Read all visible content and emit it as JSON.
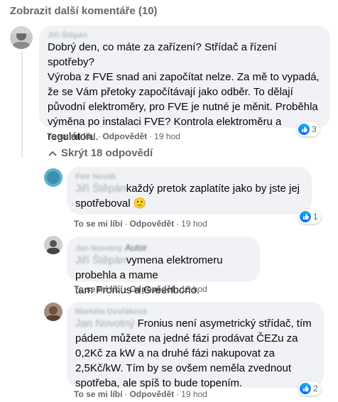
{
  "more_comments": "Zobrazit další komentáře (10)",
  "actions": {
    "like": "To se mi líbí",
    "reply": "Odpovědět",
    "sep": "·"
  },
  "reply_toggle": "Skrýt 18 odpovědí",
  "colors": {
    "like_blue": "#0866ff",
    "bubble_bg": "#f0f2f5",
    "secondary_text": "#65676b"
  },
  "main_comment": {
    "author": "Jiří Štěpán",
    "lines": [
      "Dobrý den, co máte za zařízení? Střídač a řízení spotřeby?",
      "Výroba z FVE snad ani započítat nelze. Za mě to vypadá,",
      "že se Vám přetoky započítávají jako odběr. To dělají",
      "původní elektroměry, pro FVE je nutné je měnit. Proběhla",
      "výměna po instalaci FVE? Kontrola elektroměru a",
      "regulátoru."
    ],
    "time": "19 hod",
    "reactions": "3"
  },
  "replies": [
    {
      "author": "Petr Novák",
      "mention": "Jiří Štěpán",
      "lines": [
        "každý pretok zaplatíte jako by jste jej",
        "spotřeboval 🙂"
      ],
      "time": "19 hod",
      "reactions": "1"
    },
    {
      "author": "Jan Novotný",
      "badge": "Autor",
      "mention": "Jiří Štěpán",
      "lines": [
        "vymena elektromeru probehla a mame",
        "tam Fronius a Greenbono."
      ],
      "time": "19 hod"
    },
    {
      "author": "Markéta Dvořáková",
      "mention": "Jan Novotný",
      "lines": [
        "Fronius není asymetrický střídač, tím",
        "pádem můžete na jedné fázi prodávat ČEZu za",
        "0,2Kč za kW a na druhé fázi nakupovat za",
        "2,5Kč/kW. Tím by se ovšem neměla zvednout",
        "spotřeba, ale spíš to bude topením."
      ],
      "time": "19 hod",
      "reactions": "2"
    }
  ]
}
